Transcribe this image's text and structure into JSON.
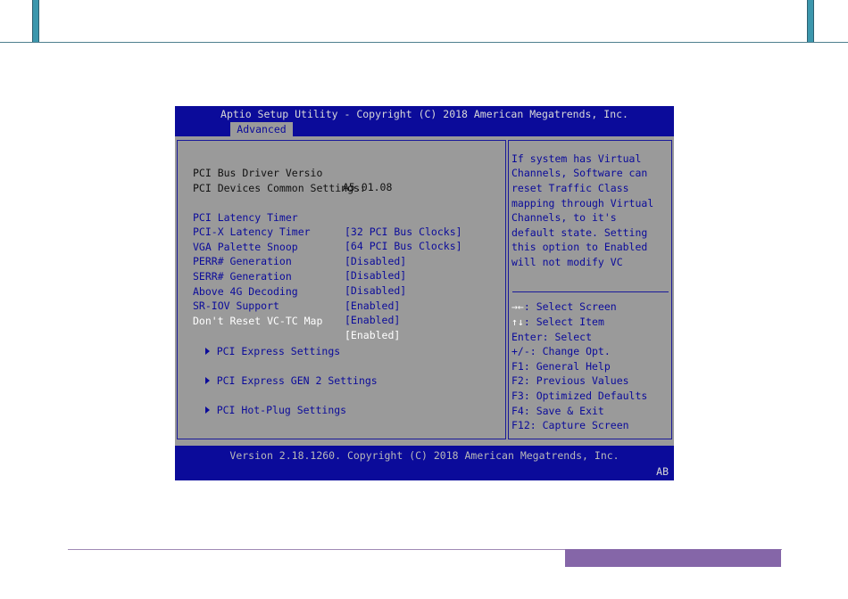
{
  "bios": {
    "title": "Aptio Setup Utility - Copyright (C) 2018 American Megatrends, Inc.",
    "active_tab": "Advanced",
    "info": {
      "driver_label": "PCI Bus Driver Versio",
      "driver_value": "A5.01.08",
      "common_heading": "PCI Devices Common Settings:"
    },
    "settings": [
      {
        "label": "PCI Latency Timer",
        "value": "[32 PCI Bus Clocks]"
      },
      {
        "label": "PCI-X Latency Timer",
        "value": "[64 PCI Bus Clocks]"
      },
      {
        "label": "VGA Palette Snoop",
        "value": "[Disabled]"
      },
      {
        "label": "PERR# Generation",
        "value": "[Disabled]"
      },
      {
        "label": "SERR# Generation",
        "value": "[Disabled]"
      },
      {
        "label": "Above 4G Decoding",
        "value": "[Enabled]"
      },
      {
        "label": "SR-IOV Support",
        "value": "[Enabled]"
      },
      {
        "label": "Don't Reset VC-TC Map",
        "value": "[Enabled]",
        "selected": true
      }
    ],
    "submenus": [
      "PCI Express Settings",
      "PCI Express GEN 2 Settings",
      "PCI Hot-Plug Settings"
    ],
    "help_text": [
      "If system has Virtual",
      "Channels, Software can",
      "reset Traffic Class",
      "mapping through Virtual",
      "Channels, to it's",
      "default state. Setting",
      "this option to Enabled",
      "will not modify VC"
    ],
    "key_help": [
      {
        "key": "→←",
        "desc": ": Select Screen"
      },
      {
        "key": "↑↓",
        "desc": ": Select Item"
      },
      {
        "key": "",
        "desc": "Enter: Select"
      },
      {
        "key": "",
        "desc": "+/-: Change Opt."
      },
      {
        "key": "",
        "desc": "F1: General Help"
      },
      {
        "key": "",
        "desc": "F2: Previous Values"
      },
      {
        "key": "",
        "desc": "F3: Optimized Defaults"
      },
      {
        "key": "",
        "desc": "F4: Save & Exit"
      },
      {
        "key": "",
        "desc": "F12: Capture Screen"
      }
    ],
    "footer": "Version 2.18.1260. Copyright (C) 2018 American Megatrends, Inc.",
    "footer_badge": "AB",
    "colors": {
      "header_bg": "#0b0b9a",
      "body_bg": "#9a9a9a",
      "highlight": "#ffffff"
    }
  }
}
